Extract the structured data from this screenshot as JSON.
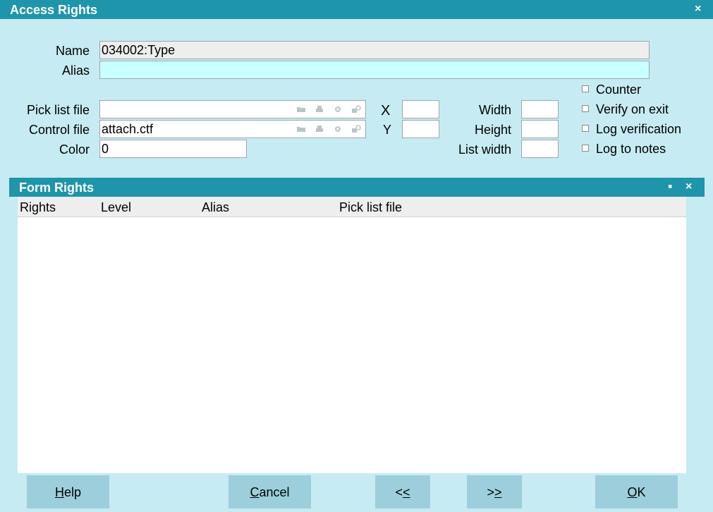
{
  "window": {
    "title": "Access Rights",
    "close": "×"
  },
  "form": {
    "name_label": "Name",
    "name_value": "034002:Type",
    "alias_label": "Alias",
    "alias_value": "",
    "picklist_label": "Pick list file",
    "picklist_value": "",
    "control_label": "Control file",
    "control_value": "attach.ctf",
    "color_label": "Color",
    "color_value": "0",
    "x_label": "X",
    "x_value": "",
    "y_label": "Y",
    "y_value": "",
    "width_label": "Width",
    "width_value": "",
    "height_label": "Height",
    "height_value": "",
    "listwidth_label": "List width",
    "listwidth_value": ""
  },
  "options": {
    "counter": "Counter",
    "verify": "Verify on exit",
    "logverif": "Log verification",
    "lognotes": "Log to notes"
  },
  "subwindow": {
    "title": "Form Rights",
    "maximize": "▪",
    "close": "×",
    "columns": [
      "Rights",
      "Level",
      "Alias",
      "Pick list file"
    ],
    "rows": []
  },
  "buttons": {
    "help_first": "H",
    "help_rest": "elp",
    "cancel_first": "C",
    "cancel_rest": "ancel",
    "prev_a": "<",
    "prev_b": "<",
    "next_a": ">",
    "next_b": ">",
    "ok_first": "O",
    "ok_rest": "K"
  },
  "colors": {
    "titlebar": "#1e95ab",
    "background": "#c7ebf2",
    "button": "#9ccfdb",
    "alias_field": "#c8ffff"
  },
  "icons": [
    "folder-icon",
    "printer-icon",
    "clear-icon",
    "lock-search-icon"
  ]
}
